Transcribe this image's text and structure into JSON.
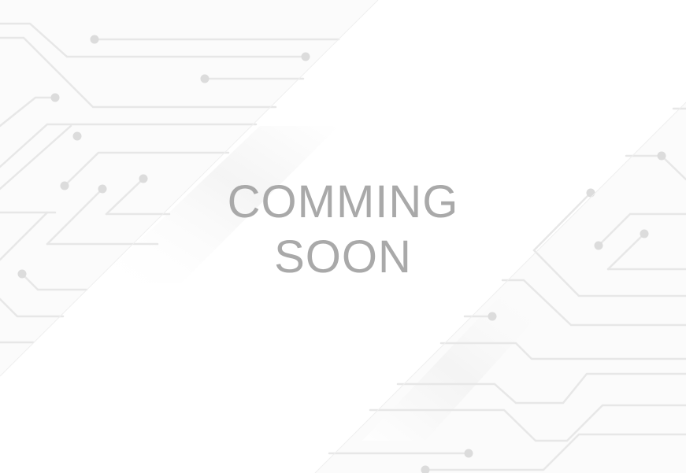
{
  "message": {
    "line1": "COMMING",
    "line2": "SOON"
  },
  "colors": {
    "background": "#ffffff",
    "text": "#a9a9a9",
    "circuit": "#e6e6e6",
    "node": "#dcdcdc",
    "shadow": "#ededed"
  }
}
